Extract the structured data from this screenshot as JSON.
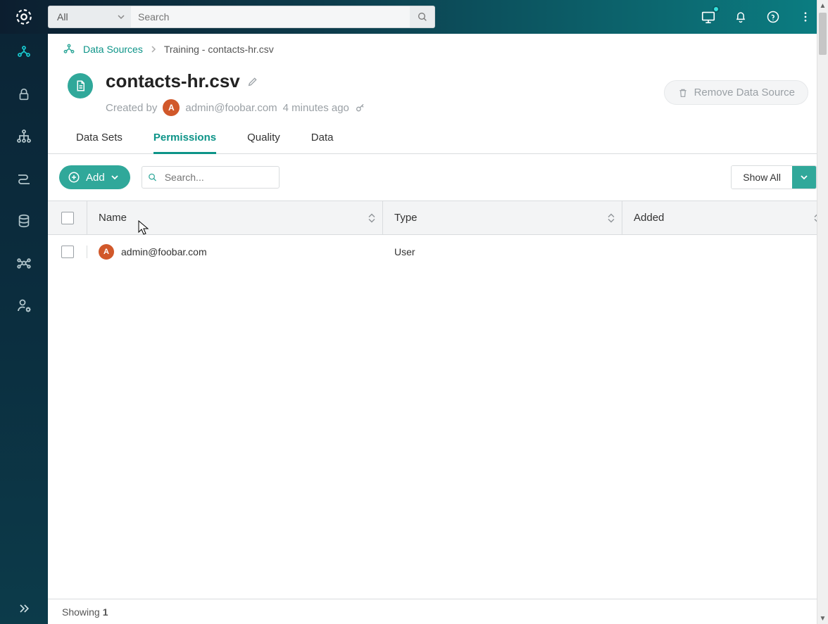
{
  "header": {
    "scope": "All",
    "search_placeholder": "Search"
  },
  "sidebar": {},
  "breadcrumb": {
    "root": "Data Sources",
    "current": "Training - contacts-hr.csv"
  },
  "page": {
    "title": "contacts-hr.csv",
    "created_by_label": "Created by",
    "created_by_user": "admin@foobar.com",
    "created_by_initial": "A",
    "created_ago": "4 minutes ago",
    "remove_label": "Remove Data Source"
  },
  "tabs": [
    "Data Sets",
    "Permissions",
    "Quality",
    "Data"
  ],
  "active_tab": "Permissions",
  "toolbar": {
    "add_label": "Add",
    "search_placeholder": "Search...",
    "showall_label": "Show All"
  },
  "table": {
    "columns": [
      "Name",
      "Type",
      "Added"
    ],
    "rows": [
      {
        "initial": "A",
        "name": "admin@foobar.com",
        "type": "User",
        "added": ""
      }
    ]
  },
  "footer": {
    "showing_label": "Showing",
    "count": "1"
  }
}
